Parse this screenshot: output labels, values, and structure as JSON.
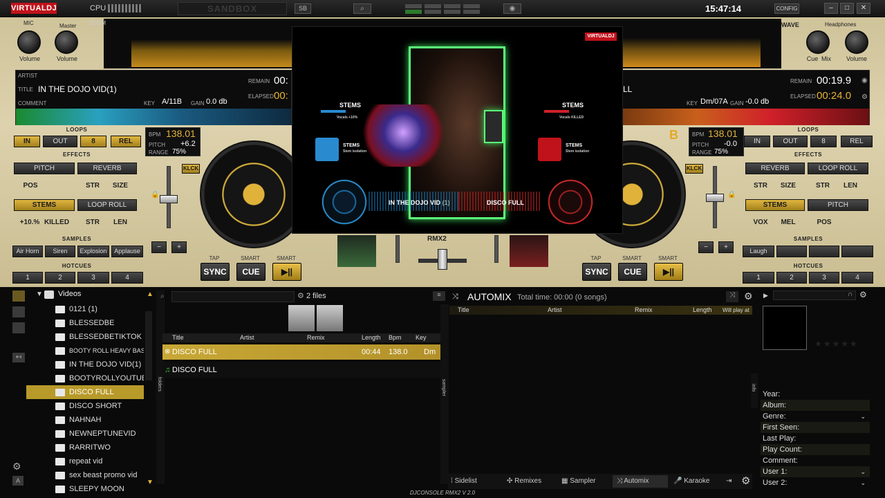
{
  "app": {
    "logo": "VIRTUALDJ",
    "cpu_label": "CPU",
    "sandbox": "SANDBOX",
    "sb": "SB",
    "clock": "15:47:14",
    "config": "CONFIG",
    "footer": "DJCONSOLE RMX2 V 2.0"
  },
  "mixer_top": {
    "mic": "MIC",
    "master": "Master",
    "zoom": "ZOOM",
    "volume": "Volume",
    "wave": "WAVE",
    "headphones": "Headphones",
    "cue": "Cue",
    "mix": "Mix"
  },
  "deckA": {
    "artist_label": "ARTIST",
    "title_label": "TITLE",
    "title": "IN THE DOJO VID(1)",
    "comment_label": "COMMENT",
    "key_label": "KEY",
    "key": "A/11B",
    "gain_label": "GAIN",
    "gain": "0.0 db",
    "remain_label": "REMAIN",
    "remain": "00:",
    "elapsed_label": "ELAPSED",
    "elapsed": "00:",
    "bpm_label": "BPM",
    "bpm": "138.01",
    "pitch_label": "PITCH",
    "pitch": "+6.2",
    "range_label": "RANGE",
    "range": "75%",
    "letter": "A",
    "klck": "KLCK",
    "loops": "LOOPS",
    "loop_in": "IN",
    "loop_out": "OUT",
    "loop_len": "8",
    "loop_rel": "REL",
    "effects": "EFFECTS",
    "fx1": "PITCH",
    "fx1_sub": "POS",
    "fx2": "REVERB",
    "fx2_sub1": "STR",
    "fx2_sub2": "SIZE",
    "fx3": "STEMS",
    "fx3_sub1": "+10.%",
    "fx3_sub2": "KILLED",
    "fx4": "LOOP ROLL",
    "fx4_sub1": "STR",
    "fx4_sub2": "LEN",
    "samples": "SAMPLES",
    "sample_items": [
      "Air Horn",
      "Siren",
      "Explosion",
      "Applause"
    ],
    "hotcues": "HOTCUES",
    "hotcue_items": [
      "1",
      "2",
      "3",
      "4"
    ],
    "minus": "−",
    "plus": "+",
    "tap": "TAP",
    "smart1": "SMART",
    "smart2": "SMART",
    "sync": "SYNC",
    "cue": "CUE",
    "play": "▶||"
  },
  "deckB": {
    "title": "LL",
    "key_label": "KEY",
    "key": "Dm/07A",
    "gain_label": "GAIN",
    "gain": "-0.0 db",
    "remain_label": "REMAIN",
    "remain": "00:19.9",
    "elapsed_label": "ELAPSED",
    "elapsed": "00:24.0",
    "bpm_label": "BPM",
    "bpm": "138.01",
    "pitch_label": "PITCH",
    "pitch": "-0.0",
    "range_label": "RANGE",
    "range": "75%",
    "letter": "B",
    "klck": "KLCK",
    "loops": "LOOPS",
    "loop_in": "IN",
    "loop_out": "OUT",
    "loop_len": "8",
    "loop_rel": "REL",
    "effects": "EFFECTS",
    "fx1": "REVERB",
    "fx1_sub1": "STR",
    "fx1_sub2": "SIZE",
    "fx2": "LOOP ROLL",
    "fx2_sub1": "STR",
    "fx2_sub2": "LEN",
    "fx3": "STEMS",
    "fx3_sub1": "VOX",
    "fx3_sub2": "MEL",
    "fx4": "PITCH",
    "fx4_sub": "POS",
    "samples": "SAMPLES",
    "sample_items": [
      "Laugh",
      "",
      "",
      ""
    ],
    "hotcues": "HOTCUES",
    "hotcue_items": [
      "1",
      "2",
      "3",
      "4"
    ],
    "minus": "−",
    "plus": "+",
    "tap": "TAP",
    "smart1": "SMART",
    "smart2": "SMART",
    "sync": "SYNC",
    "cue": "CUE",
    "play": "▶||"
  },
  "video": {
    "logo": "VIRTUALDJ",
    "stems_left": "STEMS",
    "stems_left_sub": "Vocals +10%",
    "stems_left2": "STEMS",
    "stems_left2_sub": "Stem isolation",
    "stems_right": "STEMS",
    "stems_right_sub": "Vocals KILLED",
    "stems_right2": "STEMS",
    "stems_right2_sub": "Stem isolation",
    "track_left": "IN THE DOJO VID",
    "track_left_num": "(1)",
    "track_right": "DISCO FULL",
    "center_label": "RMX2"
  },
  "browser": {
    "root": "Videos",
    "folders": [
      "0121 (1)",
      "BLESSEDBE",
      "BLESSEDBETIKTOK",
      "BOOTY ROLL HEAVY BASS SN",
      "IN THE DOJO VID(1)",
      "BOOTYROLLYOUTUBE",
      "DISCO FULL",
      "DISCO SHORT",
      "NAHNAH",
      "NEWNEPTUNEVID",
      "RARRITWO",
      "repeat vid",
      "sex beast promo vid",
      "SLEEPY MOON"
    ],
    "selected_folder": "DISCO FULL",
    "files_count": "2 files",
    "folders_tab": "folders",
    "sampler_tab": "sampler",
    "info_tab": "info",
    "columns": [
      "Title",
      "Artist",
      "Remix",
      "Length",
      "Bpm",
      "Key"
    ],
    "rows": [
      {
        "title": "DISCO FULL",
        "artist": "",
        "remix": "",
        "length": "00:44",
        "bpm": "138.0",
        "key": "Dm"
      },
      {
        "title": "DISCO FULL",
        "artist": "",
        "remix": "",
        "length": "",
        "bpm": "",
        "key": ""
      }
    ]
  },
  "automix": {
    "title": "AUTOMIX",
    "total": "Total time: 00:00 (0 songs)",
    "columns": [
      "Title",
      "Artist",
      "Remix",
      "Length",
      "Will play at"
    ]
  },
  "sidebar_info": {
    "fields": [
      "Year:",
      "Album:",
      "Genre:",
      "First Seen:",
      "Last Play:",
      "Play Count:",
      "Comment:",
      "User 1:",
      "User 2:"
    ]
  },
  "bottom_tabs": [
    "Sidelist",
    "Remixes",
    "Sampler",
    "Automix",
    "Karaoke"
  ],
  "colors": {
    "gold": "#e0b640",
    "panel": "#0c0c0c",
    "selected": "#b89a2a",
    "accent_red": "#c0121b"
  }
}
